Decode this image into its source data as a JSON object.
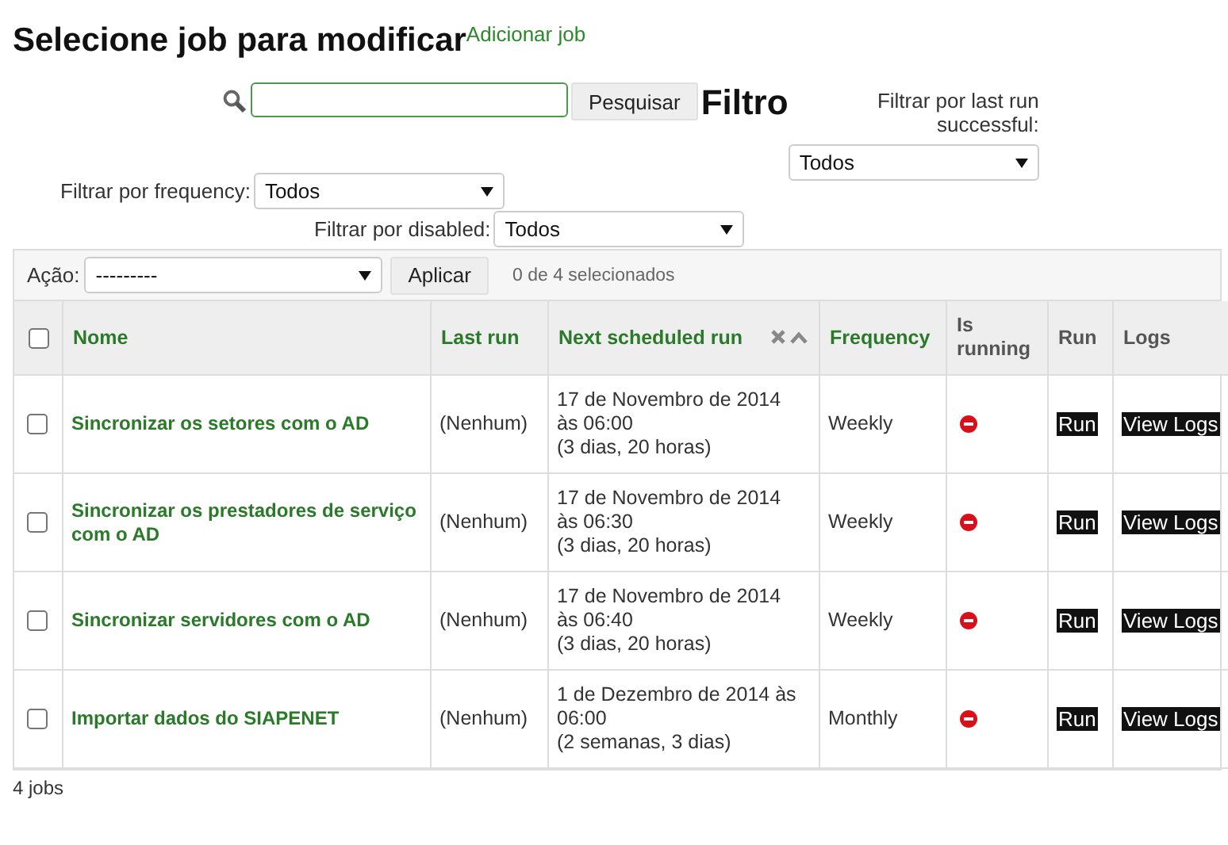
{
  "header": {
    "title": "Selecione job para modificar",
    "add_link": "Adicionar job"
  },
  "search": {
    "button": "Pesquisar"
  },
  "filter_title": "Filtro",
  "filters": [
    {
      "label": "Filtrar por last run successful:",
      "value": "Todos"
    },
    {
      "label": "Filtrar por frequency:",
      "value": "Todos"
    },
    {
      "label": "Filtrar por disabled:",
      "value": "Todos"
    }
  ],
  "actions": {
    "label": "Ação:",
    "value": "---------",
    "button": "Aplicar",
    "counter": "0 de 4 selecionados"
  },
  "table": {
    "select_all": false,
    "columns": [
      {
        "label": "Nome",
        "sortable": true,
        "sorted": false
      },
      {
        "label": "Last run",
        "sortable": true,
        "sorted": false
      },
      {
        "label": "Next scheduled run",
        "sortable": true,
        "sorted": true
      },
      {
        "label": "Frequency",
        "sortable": true,
        "sorted": false
      },
      {
        "label": "Is running",
        "sortable": false,
        "sorted": false
      },
      {
        "label": "Run",
        "sortable": false,
        "sorted": false
      },
      {
        "label": "Logs",
        "sortable": false,
        "sorted": false
      }
    ],
    "rows": [
      {
        "checked": false,
        "name": "Sincronizar os setores com o AD",
        "last_run": "(Nenhum)",
        "next_run": [
          "17 de Novembro de 2014",
          "às 06:00",
          "(3 dias, 20 horas)"
        ],
        "frequency": "Weekly",
        "is_running": false,
        "run": "Run",
        "logs": "View Logs"
      },
      {
        "checked": false,
        "name": "Sincronizar os prestadores de serviço com o AD",
        "last_run": "(Nenhum)",
        "next_run": [
          "17 de Novembro de 2014",
          "às 06:30",
          "(3 dias, 20 horas)"
        ],
        "frequency": "Weekly",
        "is_running": false,
        "run": "Run",
        "logs": "View Logs"
      },
      {
        "checked": false,
        "name": "Sincronizar servidores com o AD",
        "last_run": "(Nenhum)",
        "next_run": [
          "17 de Novembro de 2014",
          "às 06:40",
          "(3 dias, 20 horas)"
        ],
        "frequency": "Weekly",
        "is_running": false,
        "run": "Run",
        "logs": "View Logs"
      },
      {
        "checked": false,
        "name": "Importar dados do SIAPENET",
        "last_run": "(Nenhum)",
        "next_run": [
          "1 de Dezembro de 2014 às",
          "06:00",
          "(2 semanas, 3 dias)"
        ],
        "frequency": "Monthly",
        "is_running": false,
        "run": "Run",
        "logs": "View Logs"
      }
    ]
  },
  "footer": "4 jobs"
}
